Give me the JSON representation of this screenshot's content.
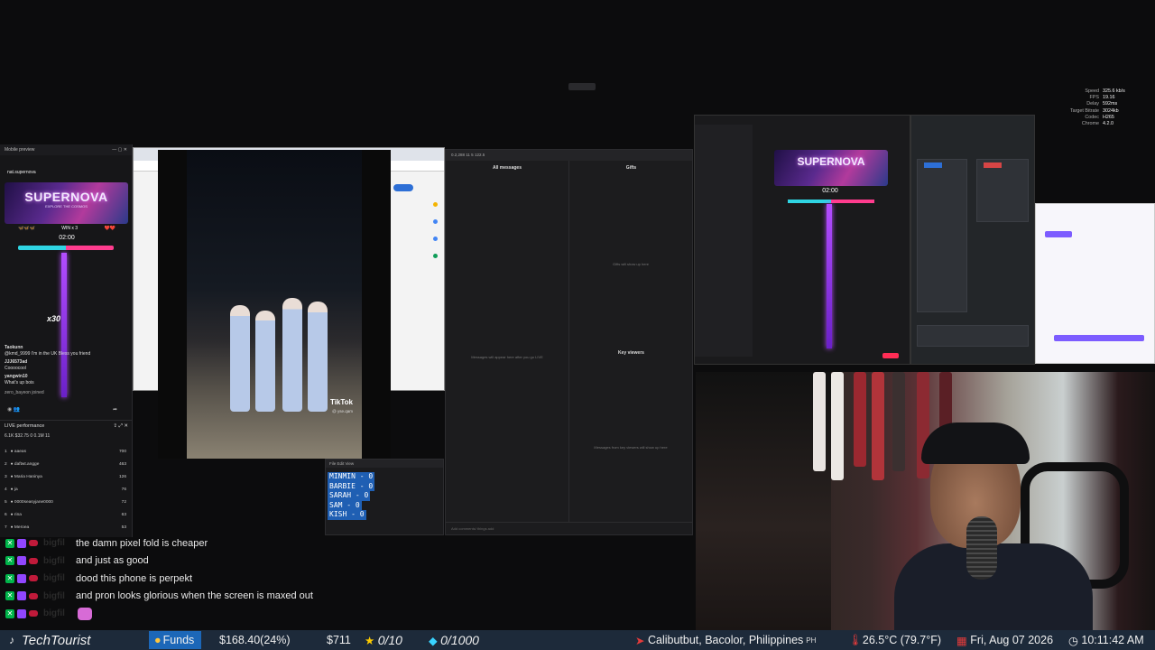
{
  "stats": [
    {
      "k": "Speed",
      "v": "325.6 kb/s"
    },
    {
      "k": "FPS",
      "v": "19.16"
    },
    {
      "k": "Delay",
      "v": "592ms"
    },
    {
      "k": "Target Bitrate",
      "v": "3024kb"
    },
    {
      "k": "Codec",
      "v": "H265"
    },
    {
      "k": "Chrome",
      "v": "4.2.0"
    }
  ],
  "mobile_preview": {
    "title": "Mobile preview",
    "account": "nat.supernova",
    "banner_title": "SUPERNOVA",
    "banner_subtitle": "EXPLORE THE COSMOS",
    "timer": "02:00",
    "win_label": "WIN x 3",
    "gift_count": "x30",
    "chat": [
      {
        "user": "Taokunn",
        "text": "@kmd_9999 I'm in the UK Bless you friend"
      },
      {
        "user": "JJJ6573ad",
        "text": "Coooocool"
      },
      {
        "user": "yangwin10",
        "text": "What's up bois"
      },
      {
        "user": "zero_bayeon",
        "text": "joined"
      }
    ]
  },
  "live_performance": {
    "title": "LIVE performance",
    "stats": "6.1K  $32.75  0  0.1M  11",
    "leaders": [
      {
        "rank": "1",
        "name": "aaeas",
        "score": "700"
      },
      {
        "rank": "2",
        "name": "daftwt.angge",
        "score": "463"
      },
      {
        "rank": "3",
        "name": "Maria Haninya",
        "score": "126"
      },
      {
        "rank": "4",
        "name": "ja",
        "score": "76"
      },
      {
        "rank": "5",
        "name": "0000seasyjane0000",
        "score": "72"
      },
      {
        "rank": "6",
        "name": "rina",
        "score": "63"
      },
      {
        "rank": "7",
        "name": "Meroea",
        "score": "53"
      }
    ]
  },
  "video": {
    "brand": "TikTok",
    "handle": "@ yse.qam"
  },
  "messages_panel": {
    "header": "0.2,288   11   5   122.5",
    "col1_title": "All messages",
    "col1_hint": "Messages will appear here after you go LIVE",
    "col2_title": "Gifts",
    "col2_hint": "Gifts will show up here",
    "col3_title": "Key viewers",
    "col3_hint": "Messages from key viewers will show up here",
    "footer": "Add comments/ things add"
  },
  "votes": {
    "menu": "File   Edit   View",
    "lines": [
      "MINMIN - 0",
      "BARBIE - 0",
      "SARAH - 0",
      "SAM - 0",
      "KISH - 0"
    ]
  },
  "studio": {
    "banner_title": "SUPERNOVA",
    "timer": "02:00"
  },
  "chat": [
    {
      "user": "bigfil",
      "text": "the damn pixel fold is cheaper"
    },
    {
      "user": "bigfil",
      "text": "and just as good"
    },
    {
      "user": "bigfil",
      "text": "dood this phone is perpekt"
    },
    {
      "user": "bigfil",
      "text": "and pron looks glorious when the screen is maxed out"
    },
    {
      "user": "bigfil",
      "text": ""
    }
  ],
  "ticker": {
    "brand": "TechTourist",
    "funds_label": "Funds",
    "funds_value": "$168.40(24%)",
    "goal": "$711",
    "stars": "0/10",
    "gems": "0/1000",
    "location": "Calibutbut, Bacolor, Philippines",
    "country": "PH",
    "temp": "26.5°C (79.7°F)",
    "date": "Fri, Aug 07 2026",
    "time": "10:11:42 AM"
  },
  "colors": {
    "ticker_bg": "#1d2a3a",
    "funds_bg": "#1c67b8",
    "accent_purple": "#b34dff"
  }
}
